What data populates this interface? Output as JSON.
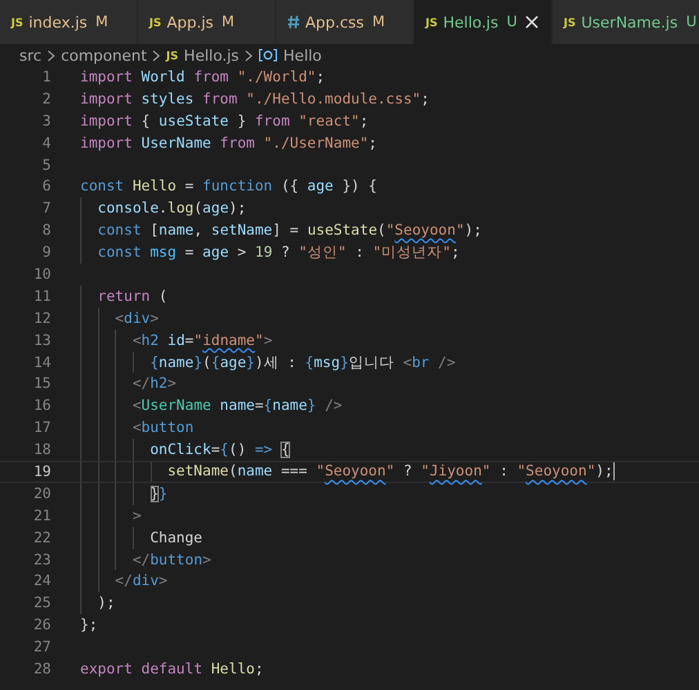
{
  "tabs": [
    {
      "label": "index.js",
      "kind": "script",
      "badge": "JS",
      "status": "M",
      "selected": false
    },
    {
      "label": "App.js",
      "kind": "script",
      "badge": "JS",
      "status": "M",
      "selected": false
    },
    {
      "label": "App.css",
      "kind": "stylesheet",
      "status": "M",
      "selected": false
    },
    {
      "label": "Hello.js",
      "kind": "script",
      "badge": "JS",
      "status": "U",
      "selected": true
    },
    {
      "label": "UserName.js",
      "kind": "script",
      "badge": "JS",
      "status": "U",
      "selected": false
    }
  ],
  "breadcrumbs": [
    {
      "label": "src",
      "kind": "folder"
    },
    {
      "label": "component",
      "kind": "folder"
    },
    {
      "label": "Hello.js",
      "kind": "file",
      "badge": "JS"
    },
    {
      "label": "Hello",
      "kind": "symbol"
    }
  ],
  "lines": [
    {
      "number": "1",
      "tokens": [
        {
          "text": "import",
          "kind": "kw"
        },
        {
          "text": " World",
          "kind": "var"
        },
        {
          "text": " from",
          "kind": "kw"
        },
        {
          "text": " \"./World\"",
          "kind": "str"
        },
        {
          "text": ";",
          "kind": "p"
        }
      ]
    },
    {
      "number": "2",
      "tokens": [
        {
          "text": "import",
          "kind": "kw"
        },
        {
          "text": " styles",
          "kind": "var"
        },
        {
          "text": " from",
          "kind": "kw"
        },
        {
          "text": " \"./Hello.module.css\"",
          "kind": "str"
        },
        {
          "text": ";",
          "kind": "p"
        }
      ]
    },
    {
      "number": "3",
      "tokens": [
        {
          "text": "import",
          "kind": "kw"
        },
        {
          "text": " { ",
          "kind": "p"
        },
        {
          "text": "useState",
          "kind": "var"
        },
        {
          "text": " } ",
          "kind": "p"
        },
        {
          "text": "from",
          "kind": "kw"
        },
        {
          "text": " \"react\"",
          "kind": "str"
        },
        {
          "text": ";",
          "kind": "p"
        }
      ]
    },
    {
      "number": "4",
      "tokens": [
        {
          "text": "import",
          "kind": "kw"
        },
        {
          "text": " UserName",
          "kind": "var"
        },
        {
          "text": " from",
          "kind": "kw"
        },
        {
          "text": " \"./UserName\"",
          "kind": "str"
        },
        {
          "text": ";",
          "kind": "p"
        }
      ]
    },
    {
      "number": "5"
    },
    {
      "number": "6",
      "tokens": [
        {
          "text": "const",
          "kind": "st"
        },
        {
          "text": " Hello",
          "kind": "fn"
        },
        {
          "text": " = ",
          "kind": "p"
        },
        {
          "text": "function",
          "kind": "st"
        },
        {
          "text": " ({ ",
          "kind": "p"
        },
        {
          "text": "age",
          "kind": "var"
        },
        {
          "text": " }) {",
          "kind": "p"
        }
      ]
    },
    {
      "number": "7",
      "tokens": [
        {
          "text": "  console",
          "kind": "var"
        },
        {
          "text": ".",
          "kind": "p"
        },
        {
          "text": "log",
          "kind": "fn"
        },
        {
          "text": "(",
          "kind": "p"
        },
        {
          "text": "age",
          "kind": "var"
        },
        {
          "text": ");",
          "kind": "p"
        }
      ]
    },
    {
      "number": "8",
      "tokens": [
        {
          "text": "  const",
          "kind": "st"
        },
        {
          "text": " [",
          "kind": "p"
        },
        {
          "text": "name",
          "kind": "var"
        },
        {
          "text": ", ",
          "kind": "p"
        },
        {
          "text": "setName",
          "kind": "var"
        },
        {
          "text": "] = ",
          "kind": "p"
        },
        {
          "text": "useState",
          "kind": "fn"
        },
        {
          "text": "(",
          "kind": "p"
        },
        {
          "text": "\"",
          "kind": "str"
        },
        {
          "text": "Seoyoon",
          "kind": "str",
          "squiggle": true
        },
        {
          "text": "\"",
          "kind": "str"
        },
        {
          "text": ");",
          "kind": "p"
        }
      ]
    },
    {
      "number": "9",
      "tokens": [
        {
          "text": "  const",
          "kind": "st"
        },
        {
          "text": " msg",
          "kind": "const"
        },
        {
          "text": " = ",
          "kind": "p"
        },
        {
          "text": "age",
          "kind": "var"
        },
        {
          "text": " > ",
          "kind": "p"
        },
        {
          "text": "19",
          "kind": "num"
        },
        {
          "text": " ? ",
          "kind": "p"
        },
        {
          "text": "\"성인\"",
          "kind": "str"
        },
        {
          "text": " : ",
          "kind": "p"
        },
        {
          "text": "\"미성년자\"",
          "kind": "str"
        },
        {
          "text": ";",
          "kind": "p"
        }
      ]
    },
    {
      "number": "10"
    },
    {
      "number": "11",
      "tokens": [
        {
          "text": "  return",
          "kind": "kw"
        },
        {
          "text": " (",
          "kind": "p"
        }
      ]
    },
    {
      "number": "12",
      "tokens": [
        {
          "text": "    <",
          "kind": "tb"
        },
        {
          "text": "div",
          "kind": "tag"
        },
        {
          "text": ">",
          "kind": "tb"
        }
      ]
    },
    {
      "number": "13",
      "tokens": [
        {
          "text": "      <",
          "kind": "tb"
        },
        {
          "text": "h2",
          "kind": "tag"
        },
        {
          "text": " id",
          "kind": "attr"
        },
        {
          "text": "=",
          "kind": "p"
        },
        {
          "text": "\"",
          "kind": "str"
        },
        {
          "text": "idname",
          "kind": "str",
          "squiggle": true
        },
        {
          "text": "\"",
          "kind": "str"
        },
        {
          "text": ">",
          "kind": "tb"
        }
      ]
    },
    {
      "number": "14",
      "tokens": [
        {
          "text": "        {",
          "kind": "br"
        },
        {
          "text": "name",
          "kind": "var"
        },
        {
          "text": "}",
          "kind": "br"
        },
        {
          "text": "(",
          "kind": "txt"
        },
        {
          "text": "{",
          "kind": "br"
        },
        {
          "text": "age",
          "kind": "var"
        },
        {
          "text": "}",
          "kind": "br"
        },
        {
          "text": ")세 : ",
          "kind": "txt"
        },
        {
          "text": "{",
          "kind": "br"
        },
        {
          "text": "msg",
          "kind": "var"
        },
        {
          "text": "}",
          "kind": "br"
        },
        {
          "text": "입니다 ",
          "kind": "txt"
        },
        {
          "text": "<",
          "kind": "tb"
        },
        {
          "text": "br",
          "kind": "tag"
        },
        {
          "text": " />",
          "kind": "tb"
        }
      ]
    },
    {
      "number": "15",
      "tokens": [
        {
          "text": "      </",
          "kind": "tb"
        },
        {
          "text": "h2",
          "kind": "tag"
        },
        {
          "text": ">",
          "kind": "tb"
        }
      ]
    },
    {
      "number": "16",
      "tokens": [
        {
          "text": "      <",
          "kind": "tb"
        },
        {
          "text": "UserName",
          "kind": "comp"
        },
        {
          "text": " name",
          "kind": "attr"
        },
        {
          "text": "=",
          "kind": "p"
        },
        {
          "text": "{",
          "kind": "br"
        },
        {
          "text": "name",
          "kind": "var"
        },
        {
          "text": "}",
          "kind": "br"
        },
        {
          "text": " />",
          "kind": "tb"
        }
      ]
    },
    {
      "number": "17",
      "tokens": [
        {
          "text": "      <",
          "kind": "tb"
        },
        {
          "text": "button",
          "kind": "tag"
        }
      ]
    },
    {
      "number": "18",
      "tokens": [
        {
          "text": "        onClick",
          "kind": "attr"
        },
        {
          "text": "=",
          "kind": "p"
        },
        {
          "text": "{",
          "kind": "br"
        },
        {
          "text": "() ",
          "kind": "p"
        },
        {
          "text": "=> ",
          "kind": "st"
        },
        {
          "text": "{",
          "kind": "p",
          "bracket_match": true
        }
      ]
    },
    {
      "number": "19",
      "current": true,
      "tokens": [
        {
          "text": "          setName",
          "kind": "fn"
        },
        {
          "text": "(",
          "kind": "p"
        },
        {
          "text": "name",
          "kind": "var"
        },
        {
          "text": " === ",
          "kind": "p"
        },
        {
          "text": "\"",
          "kind": "str"
        },
        {
          "text": "Seoyoon",
          "kind": "str",
          "squiggle": true
        },
        {
          "text": "\"",
          "kind": "str"
        },
        {
          "text": " ? ",
          "kind": "p"
        },
        {
          "text": "\"",
          "kind": "str"
        },
        {
          "text": "Jiyoon",
          "kind": "str",
          "squiggle": true
        },
        {
          "text": "\"",
          "kind": "str"
        },
        {
          "text": " : ",
          "kind": "p"
        },
        {
          "text": "\"",
          "kind": "str"
        },
        {
          "text": "Seoyoon",
          "kind": "str",
          "squiggle": true
        },
        {
          "text": "\"",
          "kind": "str"
        },
        {
          "text": ");",
          "kind": "p"
        }
      ]
    },
    {
      "number": "20",
      "tokens": [
        {
          "text": "        }",
          "kind": "p",
          "bracket_match": true
        },
        {
          "text": "}",
          "kind": "br"
        }
      ]
    },
    {
      "number": "21",
      "tokens": [
        {
          "text": "      >",
          "kind": "tb"
        }
      ]
    },
    {
      "number": "22",
      "tokens": [
        {
          "text": "        Change",
          "kind": "txt"
        }
      ]
    },
    {
      "number": "23",
      "tokens": [
        {
          "text": "      </",
          "kind": "tb"
        },
        {
          "text": "button",
          "kind": "tag"
        },
        {
          "text": ">",
          "kind": "tb"
        }
      ]
    },
    {
      "number": "24",
      "tokens": [
        {
          "text": "    </",
          "kind": "tb"
        },
        {
          "text": "div",
          "kind": "tag"
        },
        {
          "text": ">",
          "kind": "tb"
        }
      ]
    },
    {
      "number": "25",
      "tokens": [
        {
          "text": "  );",
          "kind": "p"
        }
      ]
    },
    {
      "number": "26",
      "tokens": [
        {
          "text": "};",
          "kind": "p"
        }
      ]
    },
    {
      "number": "27"
    },
    {
      "number": "28",
      "tokens": [
        {
          "text": "export",
          "kind": "kw"
        },
        {
          "text": " default",
          "kind": "kw"
        },
        {
          "text": " Hello",
          "kind": "fn"
        },
        {
          "text": ";",
          "kind": "p"
        }
      ]
    }
  ]
}
